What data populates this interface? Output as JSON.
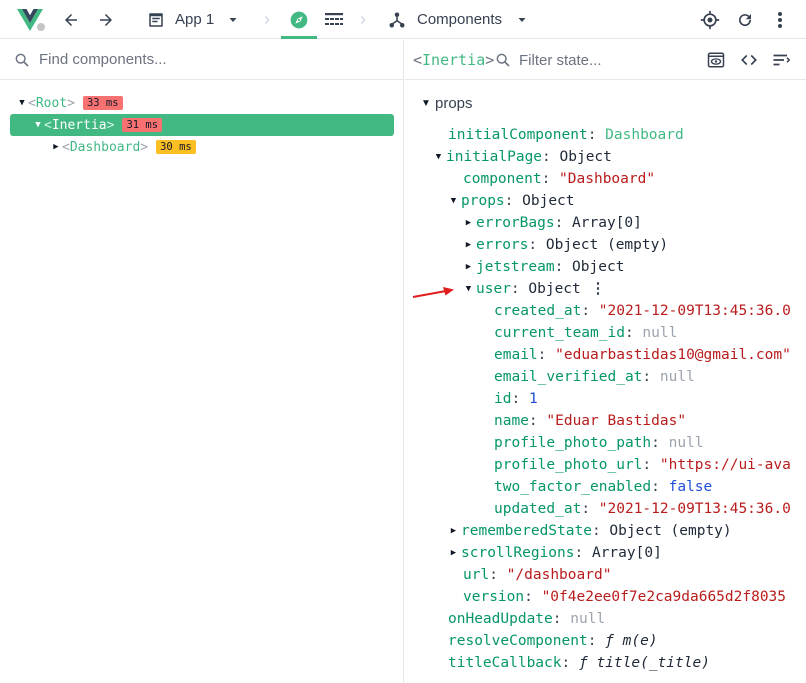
{
  "toolbar": {
    "app_label": "App 1",
    "components_label": "Components"
  },
  "left": {
    "search_placeholder": "Find components...",
    "tree": [
      {
        "name": "Root",
        "time": "33 ms"
      },
      {
        "name": "Inertia",
        "time": "31 ms"
      },
      {
        "name": "Dashboard",
        "time": "30 ms"
      }
    ]
  },
  "right": {
    "selected_component": "Inertia",
    "filter_placeholder": "Filter state...",
    "section_title": "props",
    "state": {
      "initialComponent": {
        "key": "initialComponent",
        "value": "Dashboard"
      },
      "initialPage": {
        "key": "initialPage",
        "value": "Object"
      },
      "component": {
        "key": "component",
        "value": "\"Dashboard\""
      },
      "props": {
        "key": "props",
        "value": "Object"
      },
      "errorBags": {
        "key": "errorBags",
        "value": "Array[0]"
      },
      "errors": {
        "key": "errors",
        "value": "Object (empty)"
      },
      "jetstream": {
        "key": "jetstream",
        "value": "Object"
      },
      "user": {
        "key": "user",
        "value": "Object"
      },
      "created_at": {
        "key": "created_at",
        "value": "\"2021-12-09T13:45:36.0"
      },
      "current_team_id": {
        "key": "current_team_id",
        "value": "null"
      },
      "email": {
        "key": "email",
        "value": "\"eduarbastidas10@gmail.com\""
      },
      "email_verified_at": {
        "key": "email_verified_at",
        "value": "null"
      },
      "id": {
        "key": "id",
        "value": "1"
      },
      "name": {
        "key": "name",
        "value": "\"Eduar Bastidas\""
      },
      "profile_photo_path": {
        "key": "profile_photo_path",
        "value": "null"
      },
      "profile_photo_url": {
        "key": "profile_photo_url",
        "value": "\"https://ui-ava"
      },
      "two_factor_enabled": {
        "key": "two_factor_enabled",
        "value": "false"
      },
      "updated_at": {
        "key": "updated_at",
        "value": "\"2021-12-09T13:45:36.0"
      },
      "rememberedState": {
        "key": "rememberedState",
        "value": "Object (empty)"
      },
      "scrollRegions": {
        "key": "scrollRegions",
        "value": "Array[0]"
      },
      "url": {
        "key": "url",
        "value": "\"/dashboard\""
      },
      "version": {
        "key": "version",
        "value": "\"0f4e2ee0f7e2ca9da665d2f8035"
      },
      "onHeadUpdate": {
        "key": "onHeadUpdate",
        "value": "null"
      },
      "resolveComponent": {
        "key": "resolveComponent",
        "fn_prefix": "ƒ",
        "value": "m(e)"
      },
      "titleCallback": {
        "key": "titleCallback",
        "fn_prefix": "ƒ",
        "value": "title(_title)"
      }
    }
  },
  "colors": {
    "accent": "#42b883",
    "string": "#b91c1c",
    "null": "#9ca3af",
    "number": "#1d4ed8",
    "key": "#059669",
    "time_red": "#f87171",
    "time_amber": "#fbbf24",
    "annotation_arrow": "#e11d1d"
  }
}
